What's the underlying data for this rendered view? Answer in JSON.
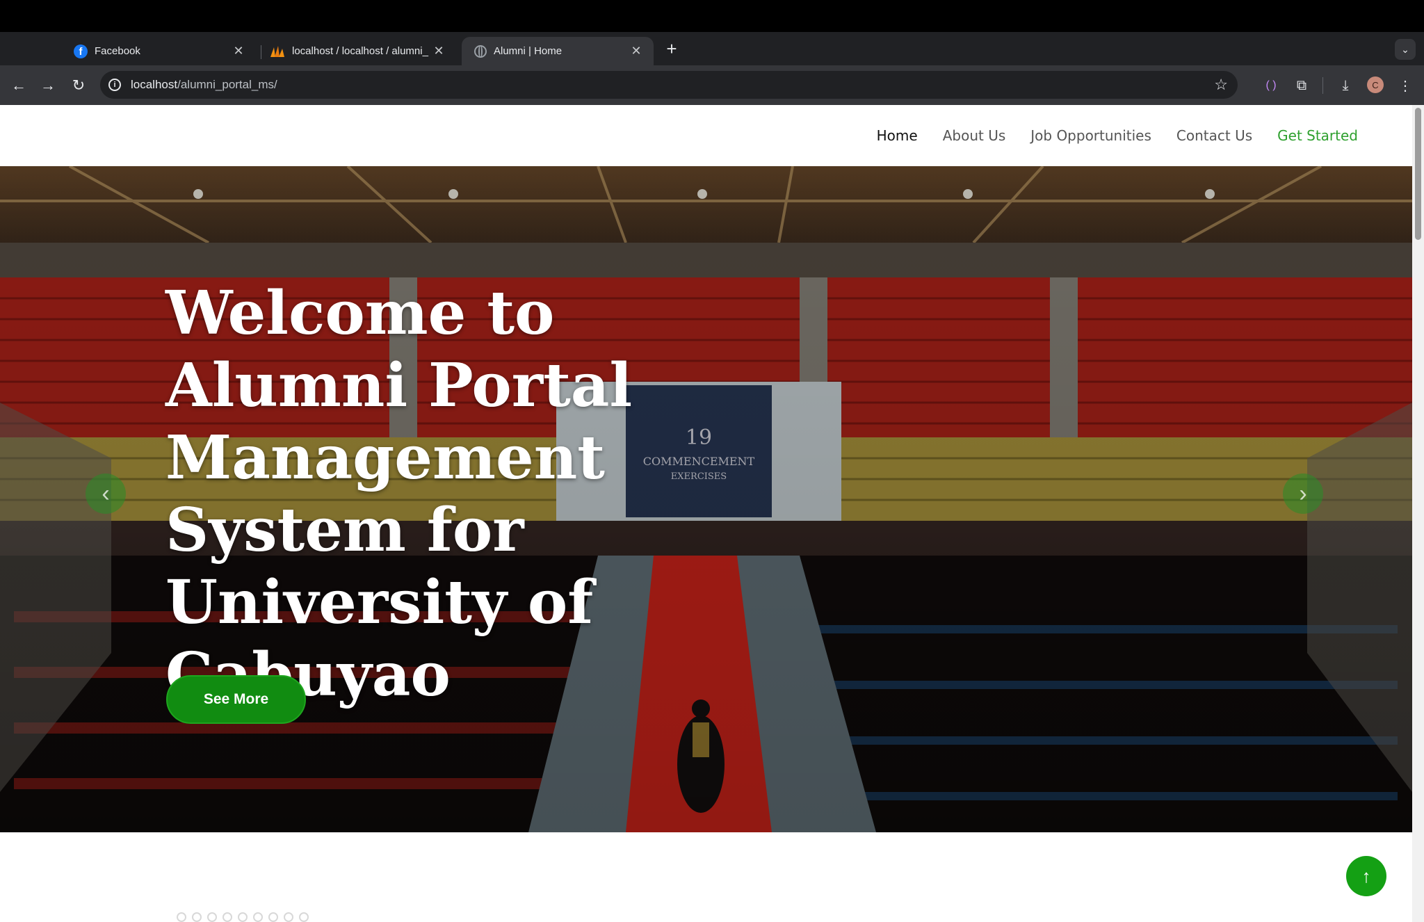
{
  "browser": {
    "tabs": [
      {
        "title": "Facebook",
        "favicon": "facebook-icon",
        "active": false
      },
      {
        "title": "localhost / localhost / alumni_",
        "favicon": "phpmyadmin-icon",
        "active": false
      },
      {
        "title": "Alumni | Home",
        "favicon": "globe-icon",
        "active": true
      }
    ],
    "url_host": "localhost",
    "url_path": "/alumni_portal_ms/",
    "profile_initial": "C"
  },
  "nav": {
    "items": [
      "Home",
      "About Us",
      "Job Opportunities",
      "Contact Us"
    ],
    "cta": "Get Started"
  },
  "hero": {
    "title": "Welcome to Alumni Portal Management System for University of Cabuyao",
    "button": "See More",
    "banner_text": "19th COMMENCEMENT EXERCISES"
  },
  "colors": {
    "accent_green": "#118c11",
    "nav_cta": "#2ea02e",
    "browser_dark": "#202124"
  }
}
